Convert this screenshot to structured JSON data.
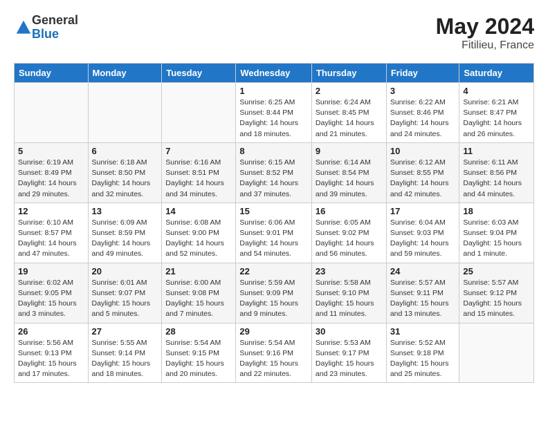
{
  "logo": {
    "general": "General",
    "blue": "Blue"
  },
  "title": {
    "month_year": "May 2024",
    "location": "Fitilieu, France"
  },
  "headers": [
    "Sunday",
    "Monday",
    "Tuesday",
    "Wednesday",
    "Thursday",
    "Friday",
    "Saturday"
  ],
  "weeks": [
    [
      {
        "day": "",
        "info": ""
      },
      {
        "day": "",
        "info": ""
      },
      {
        "day": "",
        "info": ""
      },
      {
        "day": "1",
        "info": "Sunrise: 6:25 AM\nSunset: 8:44 PM\nDaylight: 14 hours\nand 18 minutes."
      },
      {
        "day": "2",
        "info": "Sunrise: 6:24 AM\nSunset: 8:45 PM\nDaylight: 14 hours\nand 21 minutes."
      },
      {
        "day": "3",
        "info": "Sunrise: 6:22 AM\nSunset: 8:46 PM\nDaylight: 14 hours\nand 24 minutes."
      },
      {
        "day": "4",
        "info": "Sunrise: 6:21 AM\nSunset: 8:47 PM\nDaylight: 14 hours\nand 26 minutes."
      }
    ],
    [
      {
        "day": "5",
        "info": "Sunrise: 6:19 AM\nSunset: 8:49 PM\nDaylight: 14 hours\nand 29 minutes."
      },
      {
        "day": "6",
        "info": "Sunrise: 6:18 AM\nSunset: 8:50 PM\nDaylight: 14 hours\nand 32 minutes."
      },
      {
        "day": "7",
        "info": "Sunrise: 6:16 AM\nSunset: 8:51 PM\nDaylight: 14 hours\nand 34 minutes."
      },
      {
        "day": "8",
        "info": "Sunrise: 6:15 AM\nSunset: 8:52 PM\nDaylight: 14 hours\nand 37 minutes."
      },
      {
        "day": "9",
        "info": "Sunrise: 6:14 AM\nSunset: 8:54 PM\nDaylight: 14 hours\nand 39 minutes."
      },
      {
        "day": "10",
        "info": "Sunrise: 6:12 AM\nSunset: 8:55 PM\nDaylight: 14 hours\nand 42 minutes."
      },
      {
        "day": "11",
        "info": "Sunrise: 6:11 AM\nSunset: 8:56 PM\nDaylight: 14 hours\nand 44 minutes."
      }
    ],
    [
      {
        "day": "12",
        "info": "Sunrise: 6:10 AM\nSunset: 8:57 PM\nDaylight: 14 hours\nand 47 minutes."
      },
      {
        "day": "13",
        "info": "Sunrise: 6:09 AM\nSunset: 8:59 PM\nDaylight: 14 hours\nand 49 minutes."
      },
      {
        "day": "14",
        "info": "Sunrise: 6:08 AM\nSunset: 9:00 PM\nDaylight: 14 hours\nand 52 minutes."
      },
      {
        "day": "15",
        "info": "Sunrise: 6:06 AM\nSunset: 9:01 PM\nDaylight: 14 hours\nand 54 minutes."
      },
      {
        "day": "16",
        "info": "Sunrise: 6:05 AM\nSunset: 9:02 PM\nDaylight: 14 hours\nand 56 minutes."
      },
      {
        "day": "17",
        "info": "Sunrise: 6:04 AM\nSunset: 9:03 PM\nDaylight: 14 hours\nand 59 minutes."
      },
      {
        "day": "18",
        "info": "Sunrise: 6:03 AM\nSunset: 9:04 PM\nDaylight: 15 hours\nand 1 minute."
      }
    ],
    [
      {
        "day": "19",
        "info": "Sunrise: 6:02 AM\nSunset: 9:05 PM\nDaylight: 15 hours\nand 3 minutes."
      },
      {
        "day": "20",
        "info": "Sunrise: 6:01 AM\nSunset: 9:07 PM\nDaylight: 15 hours\nand 5 minutes."
      },
      {
        "day": "21",
        "info": "Sunrise: 6:00 AM\nSunset: 9:08 PM\nDaylight: 15 hours\nand 7 minutes."
      },
      {
        "day": "22",
        "info": "Sunrise: 5:59 AM\nSunset: 9:09 PM\nDaylight: 15 hours\nand 9 minutes."
      },
      {
        "day": "23",
        "info": "Sunrise: 5:58 AM\nSunset: 9:10 PM\nDaylight: 15 hours\nand 11 minutes."
      },
      {
        "day": "24",
        "info": "Sunrise: 5:57 AM\nSunset: 9:11 PM\nDaylight: 15 hours\nand 13 minutes."
      },
      {
        "day": "25",
        "info": "Sunrise: 5:57 AM\nSunset: 9:12 PM\nDaylight: 15 hours\nand 15 minutes."
      }
    ],
    [
      {
        "day": "26",
        "info": "Sunrise: 5:56 AM\nSunset: 9:13 PM\nDaylight: 15 hours\nand 17 minutes."
      },
      {
        "day": "27",
        "info": "Sunrise: 5:55 AM\nSunset: 9:14 PM\nDaylight: 15 hours\nand 18 minutes."
      },
      {
        "day": "28",
        "info": "Sunrise: 5:54 AM\nSunset: 9:15 PM\nDaylight: 15 hours\nand 20 minutes."
      },
      {
        "day": "29",
        "info": "Sunrise: 5:54 AM\nSunset: 9:16 PM\nDaylight: 15 hours\nand 22 minutes."
      },
      {
        "day": "30",
        "info": "Sunrise: 5:53 AM\nSunset: 9:17 PM\nDaylight: 15 hours\nand 23 minutes."
      },
      {
        "day": "31",
        "info": "Sunrise: 5:52 AM\nSunset: 9:18 PM\nDaylight: 15 hours\nand 25 minutes."
      },
      {
        "day": "",
        "info": ""
      }
    ]
  ]
}
